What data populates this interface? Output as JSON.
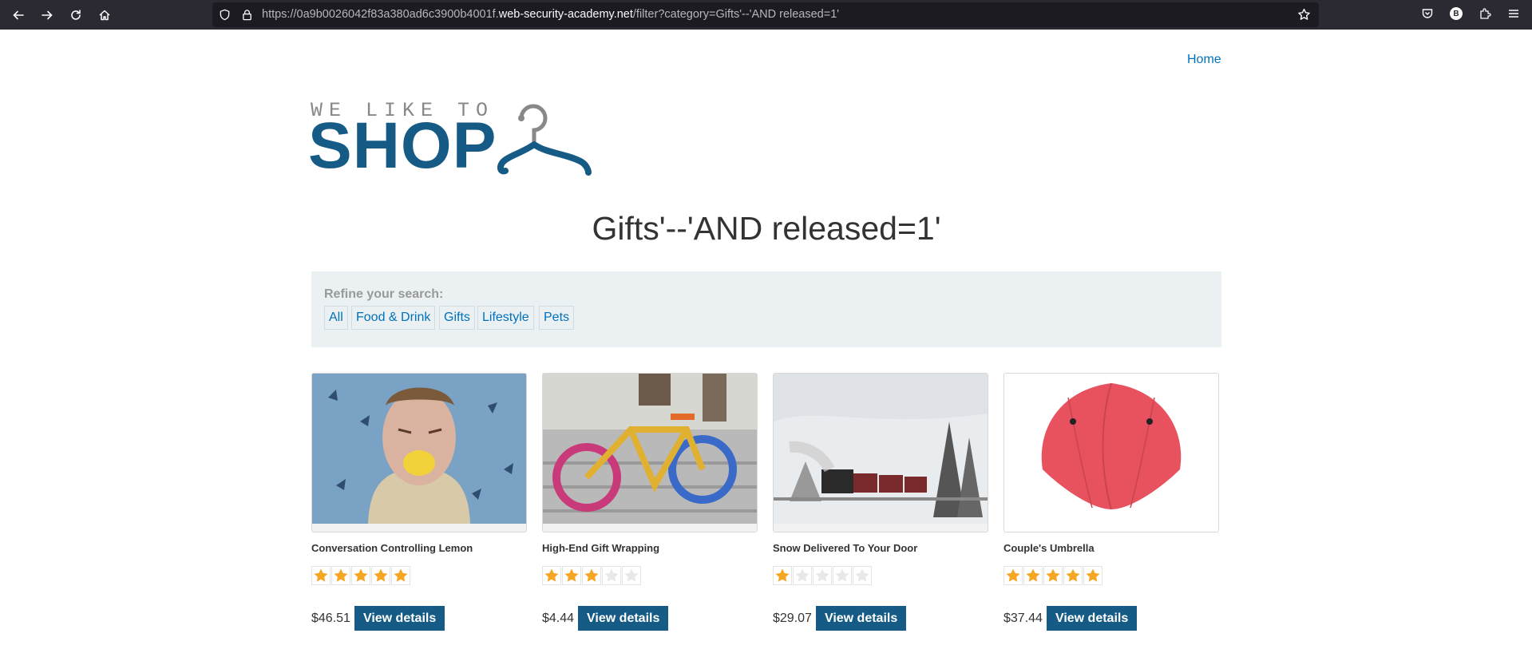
{
  "browser": {
    "url_prefix": "https://0a9b0026042f83a380ad6c3900b4001f.",
    "url_domain": "web-security-academy.net",
    "url_path": "/filter?category=Gifts'--'AND released=1'",
    "profile_initial": "B"
  },
  "header": {
    "home_label": "Home"
  },
  "logo": {
    "small_text": "WE LIKE TO",
    "big_text": "SHOP"
  },
  "page_title": "Gifts'--'AND released=1'",
  "filters": {
    "label": "Refine your search:",
    "options": [
      "All",
      "Food & Drink",
      "Gifts",
      "Lifestyle",
      "Pets"
    ]
  },
  "products": [
    {
      "name": "Conversation Controlling Lemon",
      "rating": 5,
      "price": "$46.51",
      "button": "View details",
      "image": "man-eating-lemon"
    },
    {
      "name": "High-End Gift Wrapping",
      "rating": 3,
      "price": "$4.44",
      "button": "View details",
      "image": "yarn-bombed-bicycle"
    },
    {
      "name": "Snow Delivered To Your Door",
      "rating": 1,
      "price": "$29.07",
      "button": "View details",
      "image": "steam-train-in-snow"
    },
    {
      "name": "Couple's Umbrella",
      "rating": 5,
      "price": "$37.44",
      "button": "View details",
      "image": "red-double-umbrella"
    }
  ],
  "colors": {
    "accent": "#165b85",
    "link": "#0071bc",
    "star": "#f5a623",
    "filter_bg": "#ebf0f2"
  }
}
